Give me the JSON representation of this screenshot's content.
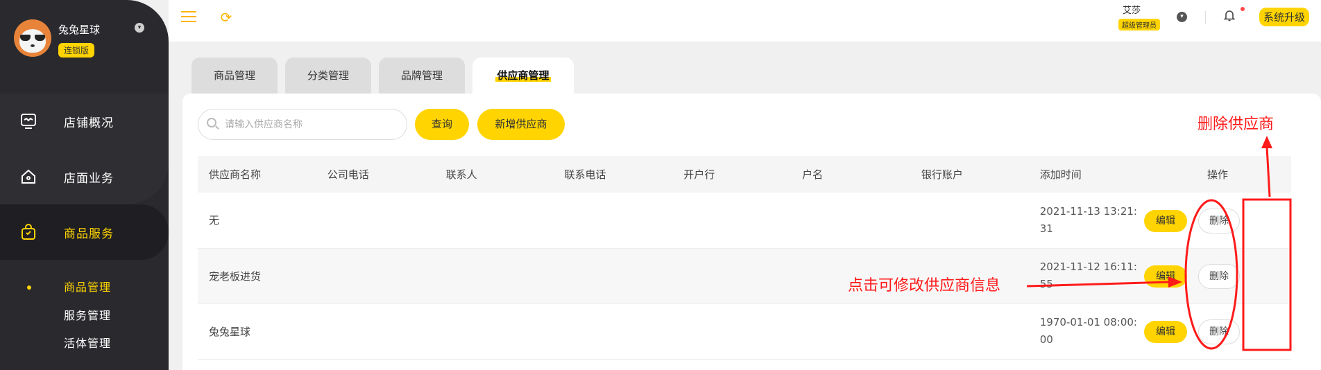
{
  "sidebar": {
    "user_name": "兔兔星球",
    "user_tag": "连锁版",
    "nav": [
      {
        "label": "店铺概况",
        "icon": "monitor-icon"
      },
      {
        "label": "店面业务",
        "icon": "home-icon"
      },
      {
        "label": "商品服务",
        "icon": "bag-icon"
      }
    ],
    "sub": [
      "商品管理",
      "服务管理",
      "活体管理"
    ]
  },
  "header": {
    "user_name": "艾莎",
    "role": "超级管理员",
    "upgrade": "系统升级"
  },
  "tabs": [
    "商品管理",
    "分类管理",
    "品牌管理",
    "供应商管理"
  ],
  "toolbar": {
    "search_placeholder": "请输入供应商名称",
    "query": "查询",
    "add": "新增供应商"
  },
  "table": {
    "columns": [
      "供应商名称",
      "公司电话",
      "联系人",
      "联系电话",
      "开户行",
      "户名",
      "银行账户",
      "添加时间",
      "操作"
    ],
    "rows": [
      {
        "name": "无",
        "time_a": "2021-11-13 13:21:",
        "time_b": "31"
      },
      {
        "name": "宠老板进货",
        "time_a": "2021-11-12 16:11:",
        "time_b": "55"
      },
      {
        "name": "兔兔星球",
        "time_a": "1970-01-01 08:00:",
        "time_b": "00"
      }
    ],
    "edit_label": "编辑",
    "delete_label": "删除"
  },
  "annotations": {
    "delete_note": "删除供应商",
    "edit_note": "点击可修改供应商信息"
  },
  "colors": {
    "accent": "#ffd400",
    "sidebar": "#2a2a2e",
    "annotation": "#ff1a1a"
  }
}
